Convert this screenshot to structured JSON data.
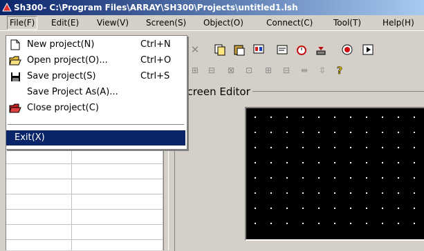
{
  "window": {
    "title": "Sh300- C:\\Program Files\\ARRAY\\SH300\\Projects\\untitled1.lsh",
    "icon": "app-icon"
  },
  "menubar": {
    "items": [
      {
        "label": "File(F)"
      },
      {
        "label": "Edit(E)"
      },
      {
        "label": "View(V)"
      },
      {
        "label": "Screen(S)"
      },
      {
        "label": "Object(O)"
      },
      {
        "label": "Connect(C)"
      },
      {
        "label": "Tool(T)"
      },
      {
        "label": "Help(H)"
      }
    ]
  },
  "file_menu": {
    "items": [
      {
        "label": "New project(N)",
        "accel": "Ctrl+N",
        "icon": "new-document-icon"
      },
      {
        "label": "Open project(O)...",
        "accel": "Ctrl+O",
        "icon": "open-folder-icon"
      },
      {
        "label": "Save project(S)",
        "accel": "Ctrl+S",
        "icon": "floppy-disk-icon"
      },
      {
        "label": "Save Project As(A)...",
        "accel": "",
        "icon": ""
      },
      {
        "label": "Close project(C)",
        "accel": "",
        "icon": "close-folder-icon"
      },
      {
        "label": "Exit(X)",
        "accel": "",
        "icon": ""
      }
    ]
  },
  "screen_editor": {
    "label": "Screen Editor"
  },
  "colors": {
    "title_start": "#0a246a",
    "title_end": "#a6caf0",
    "highlight": "#0a246a",
    "face": "#d4d0c8"
  }
}
